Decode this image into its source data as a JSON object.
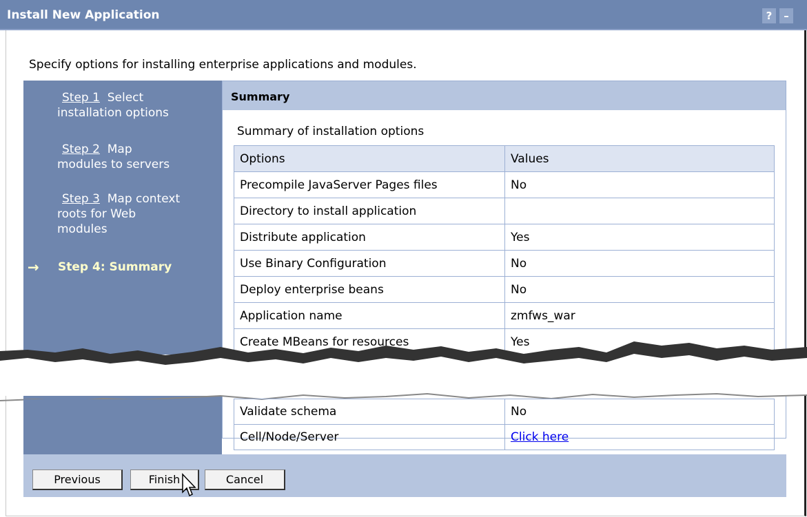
{
  "window": {
    "title": "Install New Application",
    "help_glyph": "?",
    "min_glyph": "–"
  },
  "intro": "Specify options for installing enterprise applications and modules.",
  "steps": [
    {
      "link": "Step 1",
      "text": "Select",
      "text2": "installation options"
    },
    {
      "link": "Step 2",
      "text": "Map",
      "text2": "modules to servers"
    },
    {
      "link": "Step 3",
      "text": "Map context",
      "text2": "roots for Web",
      "text3": "modules"
    },
    {
      "label": "Step 4: Summary",
      "arrow": "→"
    }
  ],
  "panel": {
    "header": "Summary",
    "caption": "Summary of installation options",
    "columns": [
      "Options",
      "Values"
    ],
    "rows": [
      [
        "Precompile JavaServer Pages files",
        "No"
      ],
      [
        "Directory to install application",
        ""
      ],
      [
        "Distribute application",
        "Yes"
      ],
      [
        "Use Binary Configuration",
        "No"
      ],
      [
        "Deploy enterprise beans",
        "No"
      ],
      [
        "Application name",
        "zmfws_war"
      ],
      [
        "Create MBeans for resources",
        "Yes"
      ]
    ],
    "rows_after_tear": [
      [
        "Validate schema",
        "No"
      ],
      [
        "Cell/Node/Server",
        "Click here"
      ]
    ]
  },
  "buttons": {
    "previous": "Previous",
    "finish": "Finish",
    "cancel": "Cancel"
  },
  "colors": {
    "titlebar": "#6d86b0",
    "nav": "#6f86ae",
    "header": "#b6c5df",
    "current_step": "#ffffcc"
  }
}
